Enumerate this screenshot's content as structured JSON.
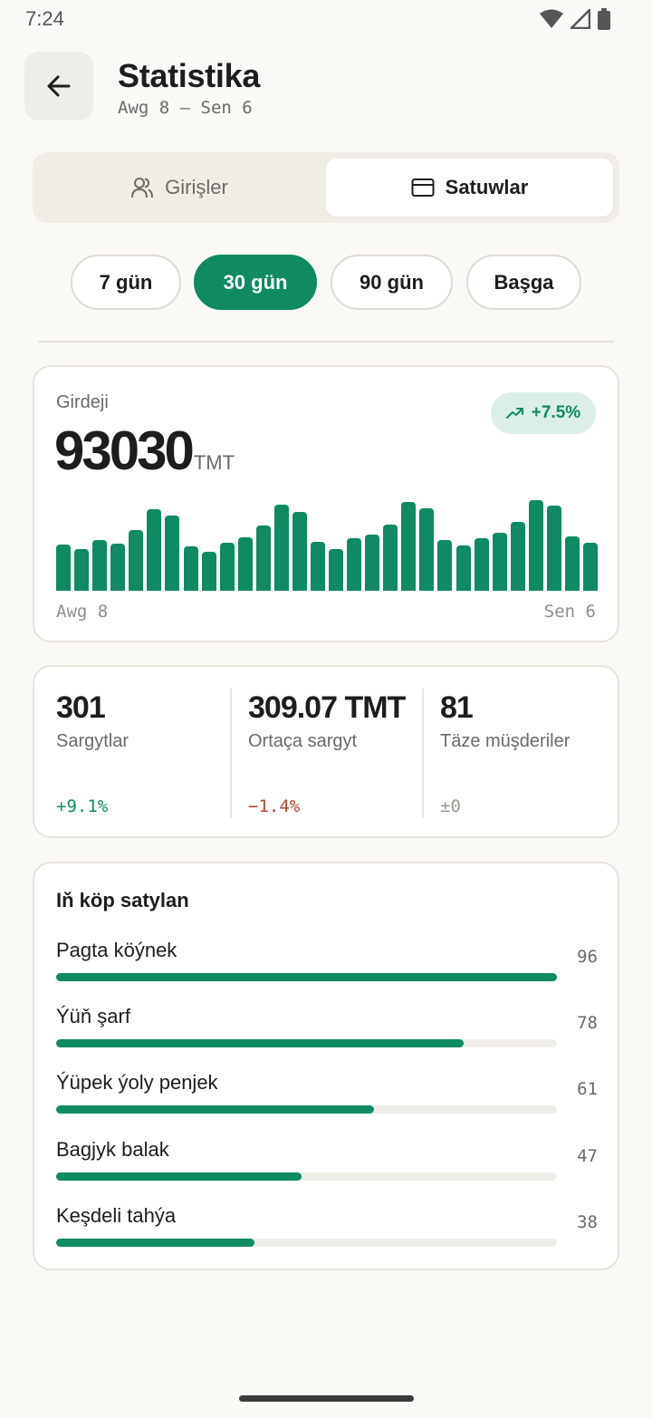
{
  "status_bar": {
    "time": "7:24",
    "icons": [
      "wifi-icon",
      "signal-icon",
      "battery-icon"
    ]
  },
  "header": {
    "title": "Statistika",
    "date_range": "Awg 8 – Sen 6",
    "back_icon": "arrow-left-icon"
  },
  "tabs": [
    {
      "label": "Girişler",
      "icon": "users-icon",
      "selected": false
    },
    {
      "label": "Satuwlar",
      "icon": "credit-card-icon",
      "selected": true
    }
  ],
  "periods": [
    {
      "label": "7 gün",
      "selected": false
    },
    {
      "label": "30 gün",
      "selected": true
    },
    {
      "label": "90 gün",
      "selected": false
    },
    {
      "label": "Başga",
      "selected": false
    }
  ],
  "revenue": {
    "label": "Girdeji",
    "value": "93030",
    "unit": "TMT",
    "growth": "+7.5%",
    "growth_icon": "trending-up-icon",
    "axis_start": "Awg 8",
    "axis_end": "Sen 6"
  },
  "chart_data": {
    "type": "bar",
    "categories": [],
    "values": [
      51,
      46,
      56,
      52,
      67,
      90,
      83,
      49,
      43,
      53,
      59,
      72,
      95,
      87,
      54,
      46,
      58,
      62,
      73,
      98,
      91,
      56,
      50,
      58,
      64,
      76,
      100,
      94,
      60,
      53
    ],
    "ylim": [
      0,
      100
    ],
    "x_start_label": "Awg 8",
    "x_end_label": "Sen 6",
    "color": "#0f8a63"
  },
  "stats": [
    {
      "value": "301",
      "label": "Sargytlar",
      "delta": "+9.1%",
      "tone": "positive"
    },
    {
      "value": "309.07 TMT",
      "label": "Ortaça sargyt",
      "delta": "−1.4%",
      "tone": "negative"
    },
    {
      "value": "81",
      "label": "Täze müşderiler",
      "delta": "±0",
      "tone": "neutral"
    }
  ],
  "top_products": {
    "title": "Iň köp satylan",
    "max": 96,
    "items": [
      {
        "name": "Pagta köýnek",
        "count": 96
      },
      {
        "name": "Ýüň şarf",
        "count": 78
      },
      {
        "name": "Ýüpek ýoly penjek",
        "count": 61
      },
      {
        "name": "Bagjyk balak",
        "count": 47
      },
      {
        "name": "Keşdeli tahýa",
        "count": 38
      }
    ]
  },
  "colors": {
    "accent": "#0f8a63",
    "negative": "#b5452f",
    "neutral": "#9a9891",
    "background": "#faf9f6"
  }
}
